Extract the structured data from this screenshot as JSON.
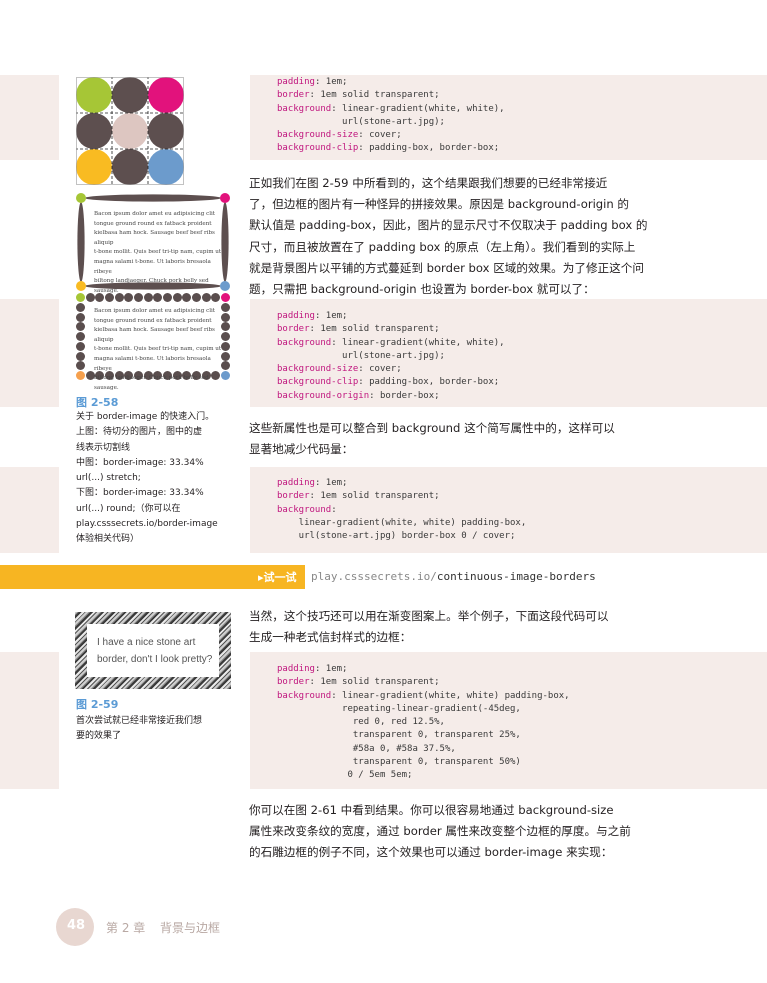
{
  "code_blocks": [
    {
      "lines": [
        [
          [
            "prop",
            "padding"
          ],
          [
            "val",
            ": 1em;"
          ]
        ],
        [
          [
            "prop",
            "border"
          ],
          [
            "val",
            ": 1em solid transparent;"
          ]
        ],
        [
          [
            "prop",
            "background"
          ],
          [
            "val",
            ": linear-gradient(white, white),"
          ]
        ],
        [
          [
            "val",
            "            url(stone-art.jpg);"
          ]
        ],
        [
          [
            "prop",
            "background-size"
          ],
          [
            "val",
            ": cover;"
          ]
        ],
        [
          [
            "prop",
            "background-clip"
          ],
          [
            "val",
            ": padding-box, border-box;"
          ]
        ]
      ]
    },
    {
      "lines": [
        [
          [
            "prop",
            "padding"
          ],
          [
            "val",
            ": 1em;"
          ]
        ],
        [
          [
            "prop",
            "border"
          ],
          [
            "val",
            ": 1em solid transparent;"
          ]
        ],
        [
          [
            "prop",
            "background"
          ],
          [
            "val",
            ": linear-gradient(white, white),"
          ]
        ],
        [
          [
            "val",
            "            url(stone-art.jpg);"
          ]
        ],
        [
          [
            "prop",
            "background-size"
          ],
          [
            "val",
            ": cover;"
          ]
        ],
        [
          [
            "prop",
            "background-clip"
          ],
          [
            "val",
            ": padding-box, border-box;"
          ]
        ],
        [
          [
            "prop",
            "background-origin"
          ],
          [
            "val",
            ": border-box;"
          ]
        ]
      ]
    },
    {
      "lines": [
        [
          [
            "prop",
            "padding"
          ],
          [
            "val",
            ": 1em;"
          ]
        ],
        [
          [
            "prop",
            "border"
          ],
          [
            "val",
            ": 1em solid transparent;"
          ]
        ],
        [
          [
            "prop",
            "background"
          ],
          [
            "val",
            ":"
          ]
        ],
        [
          [
            "val",
            "    linear-gradient(white, white) padding-box,"
          ]
        ],
        [
          [
            "val",
            "    url(stone-art.jpg) border-box 0 / cover;"
          ]
        ]
      ]
    },
    {
      "lines": [
        [
          [
            "prop",
            "padding"
          ],
          [
            "val",
            ": 1em;"
          ]
        ],
        [
          [
            "prop",
            "border"
          ],
          [
            "val",
            ": 1em solid transparent;"
          ]
        ],
        [
          [
            "prop",
            "background"
          ],
          [
            "val",
            ": linear-gradient(white, white) padding-box,"
          ]
        ],
        [
          [
            "val",
            "            repeating-linear-gradient(-45deg,"
          ]
        ],
        [
          [
            "val",
            "              red 0, red 12.5%,"
          ]
        ],
        [
          [
            "val",
            "              transparent 0, transparent 25%,"
          ]
        ],
        [
          [
            "val",
            "              #58a 0, #58a 37.5%,"
          ]
        ],
        [
          [
            "val",
            "              transparent 0, transparent 50%)"
          ]
        ],
        [
          [
            "val",
            "             0 / 5em 5em;"
          ]
        ]
      ]
    }
  ],
  "paragraphs": {
    "p1": [
      "正如我们在图 2-59 中所看到的，这个结果跟我们想要的已经非常接近",
      "了，但边框的图片有一种怪异的拼接效果。原因是 background-origin 的",
      "默认值是 padding-box，因此，图片的显示尺寸不仅取决于 padding box 的",
      "尺寸，而且被放置在了 padding box 的原点（左上角）。我们看到的实际上",
      "就是背景图片以平铺的方式蔓延到 border box 区域的效果。为了修正这个问",
      "题，只需把 background-origin 也设置为 border-box 就可以了："
    ],
    "p2": [
      "这些新属性也是可以整合到 background 这个简写属性中的，这样可以",
      "显著地减少代码量："
    ],
    "p3": [
      "当然，这个技巧还可以用在渐变图案上。举个例子，下面这段代码可以",
      "生成一种老式信封样式的边框："
    ],
    "p4": [
      "你可以在图 2-61 中看到结果。你可以很容易地通过 background-size",
      "属性来改变条纹的宽度，通过 border 属性来改变整个边框的厚度。与之前",
      "的石雕边框的例子不同，这个效果也可以通过 border-image 来实现："
    ]
  },
  "fig58": {
    "title": "图 2-58",
    "caption_lines": [
      "关于 border-image 的快速入门。",
      "上图：待切分的图片，图中的虚",
      "线表示切割线",
      "中图：border-image: 33.34%",
      "url(...) stretch;",
      "下图：border-image: 33.34%",
      "url(...) round;（你可以在",
      "play.csssecrets.io/border-image",
      "体验相关代码）"
    ],
    "card_lines": [
      "Bacon ipsum dolor amet eu adipisicing clit",
      "tongue ground round ex fatback proident",
      "kielbasa ham hock. Sausage beef beef ribs aliquip",
      "t-bone mollit. Quis beef tri-tip nam, cupim ut",
      "magna salami t-bone. Ut laboris bresaola ribeye",
      "biltong landjaeger. Chuck pork belly sed sausage."
    ],
    "colors": {
      "green": "#a6c636",
      "magenta": "#e2127c",
      "brown": "#5d4f4f",
      "pink": "#ddc6c1",
      "yellow": "#f9bb22",
      "blue": "#6c9bcc",
      "orange": "#f6a04d"
    }
  },
  "fig59": {
    "title": "图 2-59",
    "caption_lines": [
      "首次尝试就已经非常接近我们想",
      "要的效果了"
    ],
    "text_lines": [
      "I have a nice stone art",
      "border, don't I look pretty?"
    ]
  },
  "try_it": {
    "label": "▸试一试",
    "url_prefix": "play.csssecrets.io/",
    "url_path": "continuous-image-borders",
    "color": "#f7b522"
  },
  "footer": {
    "page_number": "48",
    "chapter": "第 2 章",
    "chapter_title": "背景与边框"
  }
}
